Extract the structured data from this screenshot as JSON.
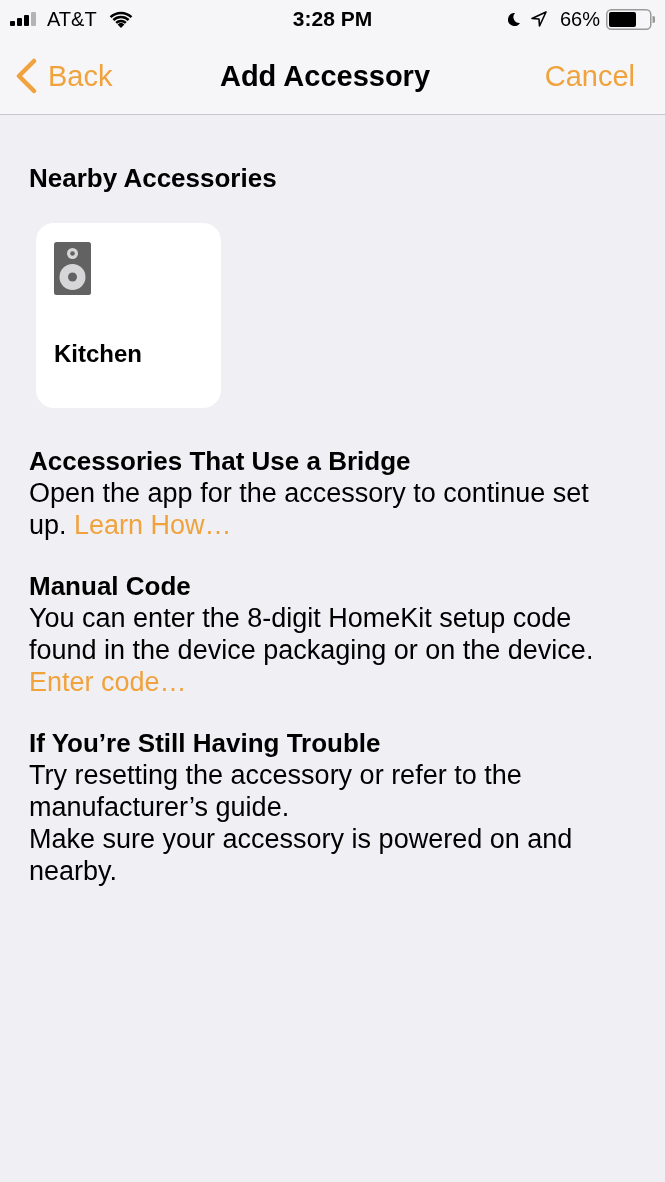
{
  "status_bar": {
    "carrier": "AT&T",
    "time": "3:28 PM",
    "battery": "66%"
  },
  "nav_bar": {
    "back": "Back",
    "title": "Add Accessory",
    "cancel": "Cancel"
  },
  "nearby": {
    "title": "Nearby Accessories",
    "accessories": [
      {
        "name": "Kitchen",
        "kind": "speaker"
      }
    ]
  },
  "sections": [
    {
      "title": "Accessories That Use a Bridge",
      "paragraphs": [
        {
          "text": "Open the app for the accessory to continue set up.",
          "link": "Learn How…"
        }
      ]
    },
    {
      "title": "Manual Code",
      "paragraphs": [
        {
          "text": "You can enter the 8-digit HomeKit setup code found in the device packaging or on the device."
        },
        {
          "link": "Enter code…"
        }
      ]
    },
    {
      "title": "If You’re Still Having Trouble",
      "paragraphs": [
        {
          "text": "Try resetting the accessory or refer to the manufacturer’s guide."
        },
        {
          "text": "Make sure your accessory is powered on and nearby."
        }
      ]
    }
  ]
}
